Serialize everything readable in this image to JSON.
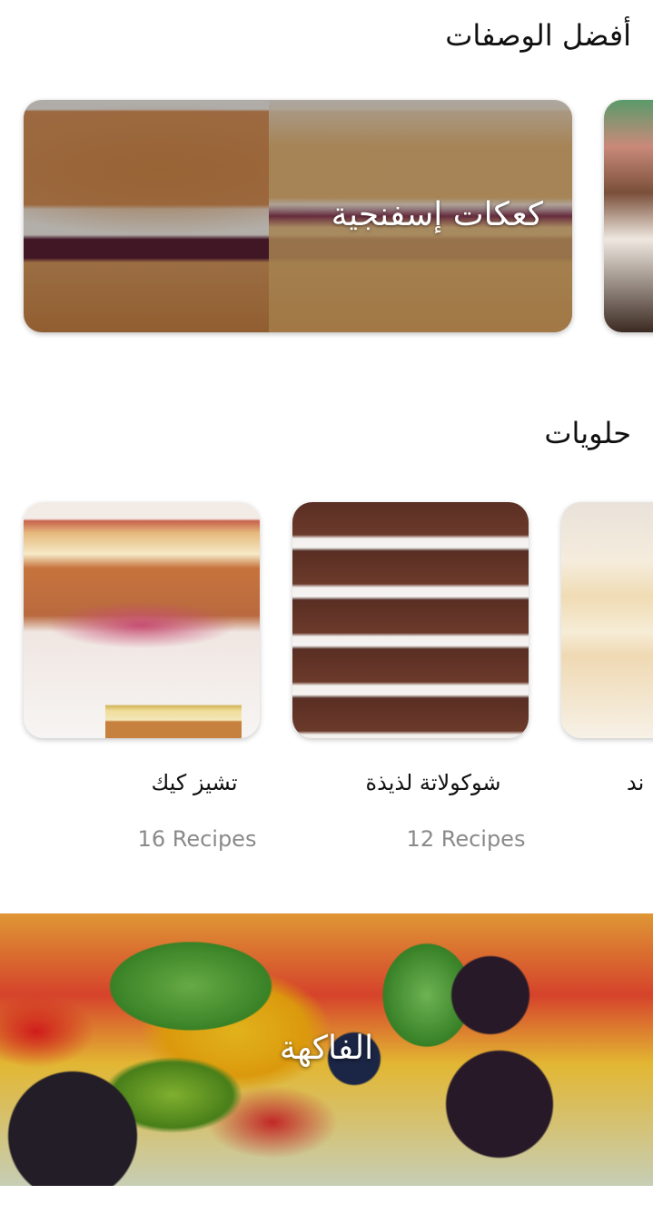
{
  "best_recipes": {
    "title": "أفضل الوصفات",
    "cards": [
      {
        "label": "كعكات إسفنجية"
      }
    ]
  },
  "sweets": {
    "title": "حلويات",
    "items": [
      {
        "title": "تشيز كيك",
        "count": "16 Recipes"
      },
      {
        "title": "شوكولاتة لذيذة",
        "count": "12 Recipes"
      },
      {
        "title": "ند"
      }
    ]
  },
  "fruit": {
    "label": "الفاكهة"
  }
}
